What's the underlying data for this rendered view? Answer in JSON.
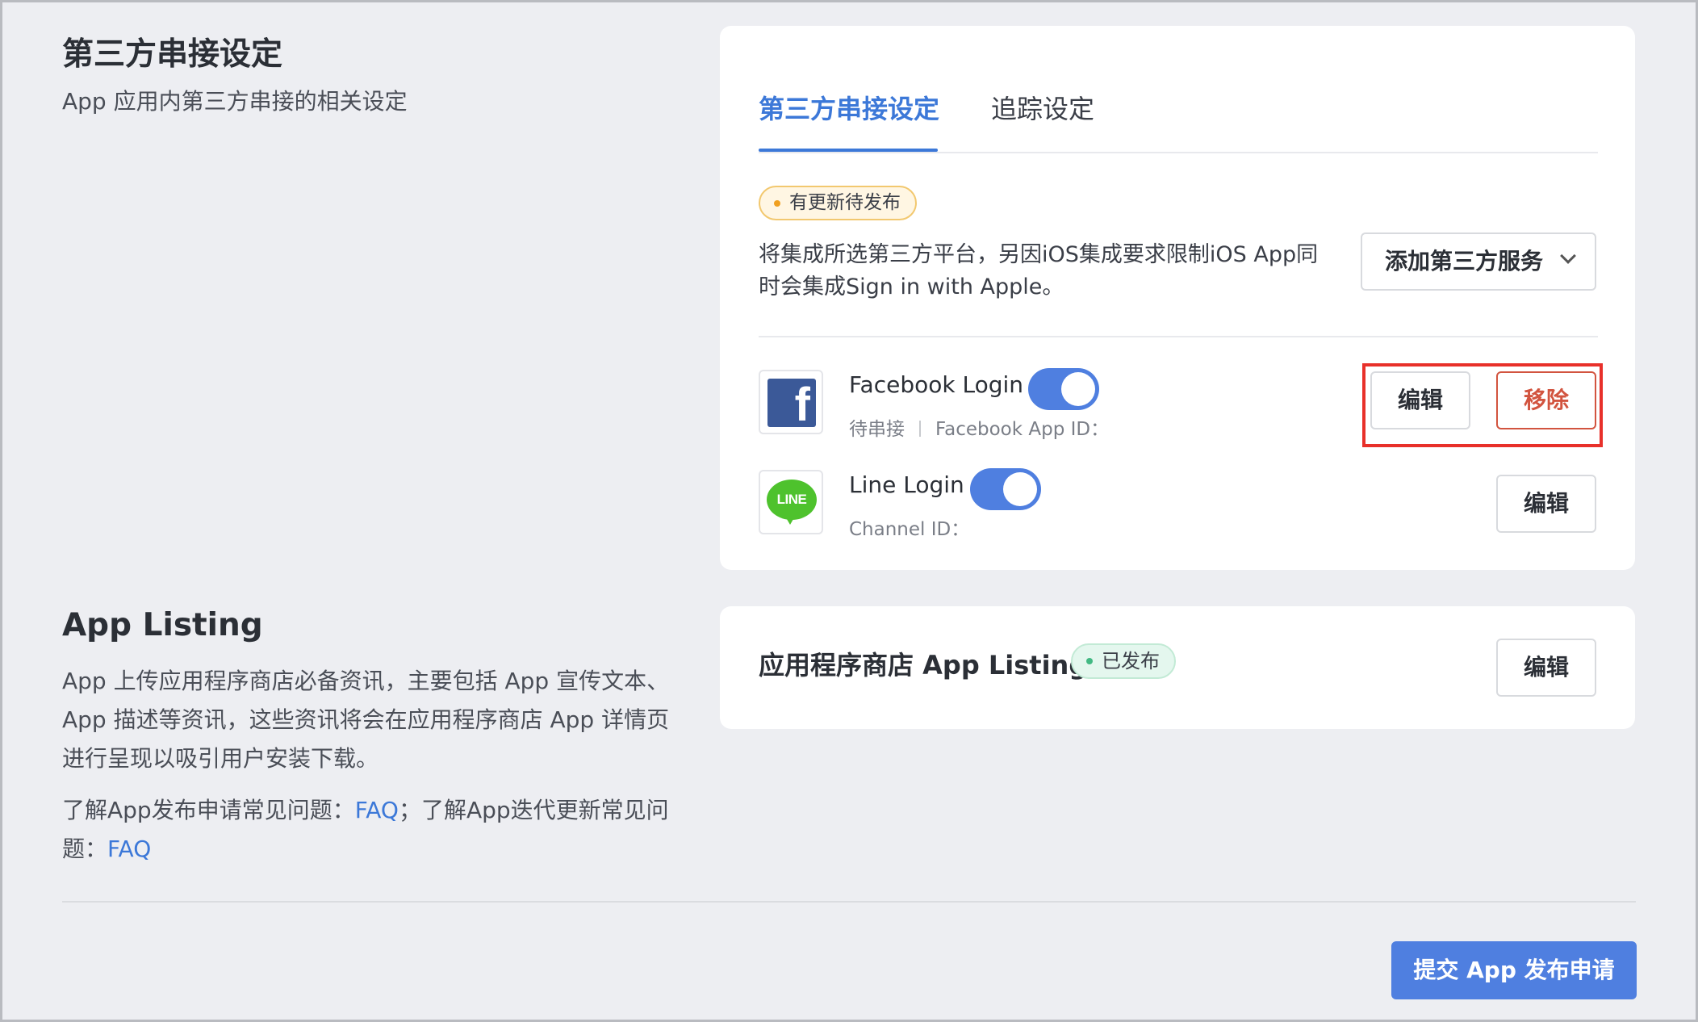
{
  "integration_section": {
    "title": "第三方串接设定",
    "description": "App 应用内第三方串接的相关设定"
  },
  "listing_section": {
    "title": "App Listing",
    "description": "App 上传应用程序商店必备资讯，主要包括 App 宣传文本、App 描述等资讯，这些资讯将会在应用程序商店 App 详情页进行呈现以吸引用户安装下载。",
    "faq_prefix": "了解App发布申请常见问题：",
    "faq_link_1": "FAQ",
    "faq_middle": "；了解App迭代更新常见问题：",
    "faq_link_2": "FAQ"
  },
  "tabs": [
    {
      "label": "第三方串接设定",
      "active": true
    },
    {
      "label": "追踪设定",
      "active": false
    }
  ],
  "pending_badge": "有更新待发布",
  "integration_note": "将集成所选第三方平台，另因iOS集成要求限制iOS App同时会集成Sign in with Apple。",
  "add_service_button": "添加第三方服务",
  "services": [
    {
      "name": "Facebook Login",
      "enabled": true,
      "status": "待串接",
      "id_label": "Facebook App ID：",
      "icon": "facebook-icon",
      "edit_label": "编辑",
      "remove_label": "移除"
    },
    {
      "name": "Line Login",
      "enabled": true,
      "id_label": "Channel ID：",
      "icon": "line-icon",
      "icon_text": "LINE",
      "edit_label": "编辑"
    }
  ],
  "app_listing_card": {
    "title": "应用程序商店 App Listing",
    "badge": "已发布",
    "edit_label": "编辑"
  },
  "submit_button": "提交 App 发布申请",
  "colors": {
    "accent": "#3c78d8",
    "toggle_on": "#4f7fe0",
    "remove": "#d2543f",
    "highlight": "#e8302a",
    "pending_badge": "#fff6e3",
    "published_badge": "#e4f7ee"
  }
}
